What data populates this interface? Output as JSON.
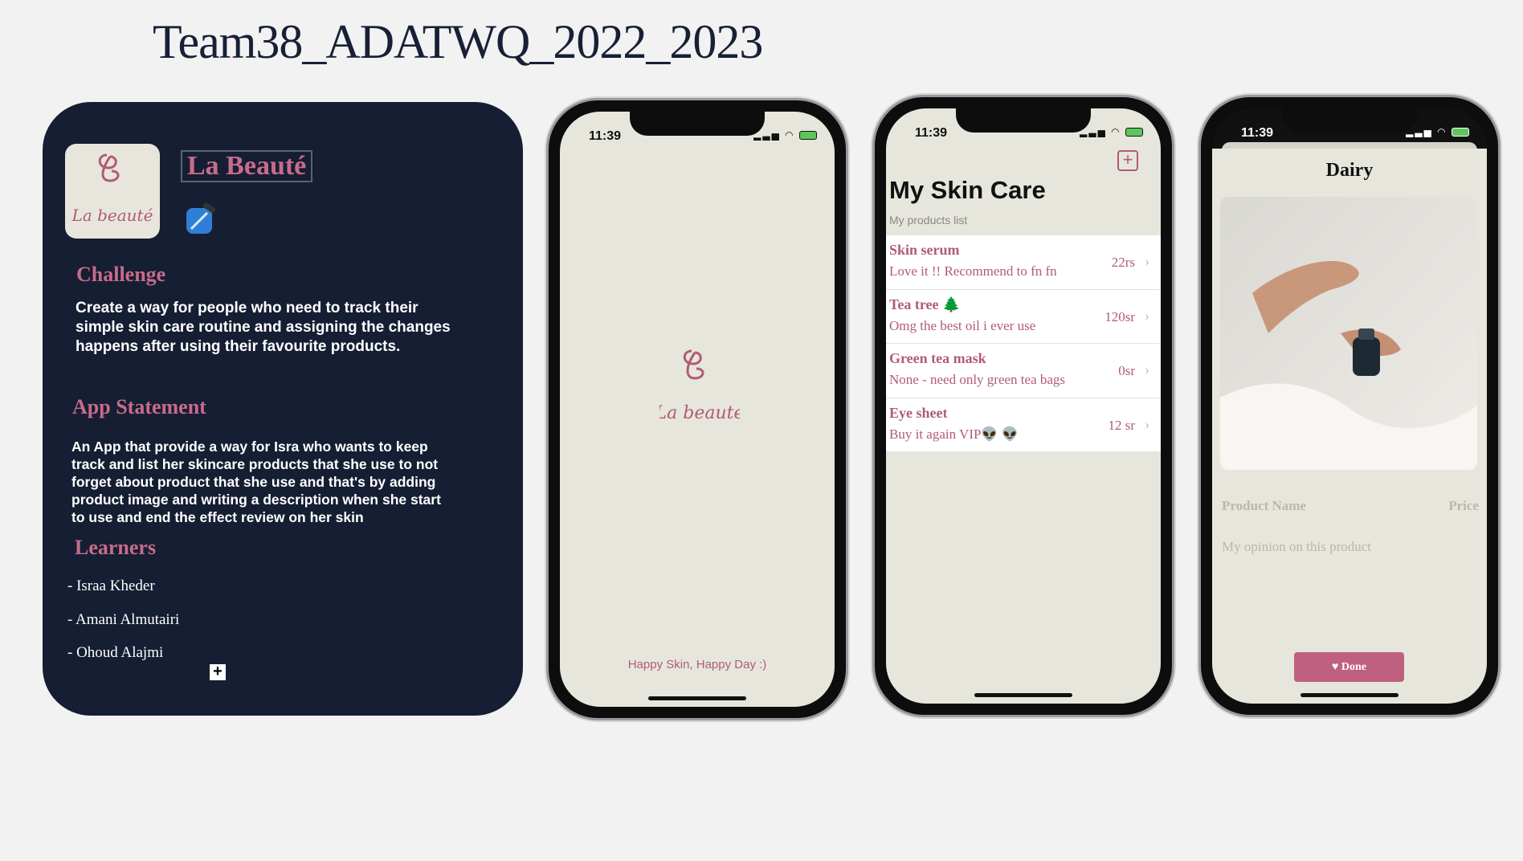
{
  "title": "Team38_ADATWQ_2022_2023",
  "colors": {
    "navy": "#151e33",
    "rose": "#c86b8a",
    "beige": "#e7e6dc"
  },
  "card": {
    "logo_text": "La beauté",
    "brand_name": "La Beauté",
    "icons": [
      "app-logo-icon",
      "xcode-icon"
    ],
    "challenge_heading": "Challenge",
    "challenge_text": "Create a way for people who need to track their simple skin care routine and assigning the changes happens after using their favourite products.",
    "statement_heading": "App Statement",
    "statement_text": "An App that provide a way for Isra who wants to keep track and list her skincare products that she use to not forget about product that she use and that's by adding product image and writing a description when she start to use and end the effect review on her skin",
    "learners_heading": "Learners",
    "learners": [
      "-  Israa Kheder",
      "-  Amani Almutairi",
      "- Ohoud  Alajmi"
    ],
    "plus_symbol": "+"
  },
  "splash": {
    "time": "11:39",
    "logo_text": "La beauté",
    "tagline": "Happy Skin, Happy Day :)"
  },
  "list_screen": {
    "time": "11:39",
    "add_symbol": "+",
    "title": "My Skin Care",
    "subtitle": "My products list",
    "chevron": "›",
    "rows": [
      {
        "name": "Skin serum",
        "desc": "Love it !! Recommend to fn fn",
        "price": "22rs"
      },
      {
        "name": "Tea tree 🌲",
        "desc": "Omg the best oil i ever use",
        "price": "120sr"
      },
      {
        "name": "Green tea mask",
        "desc": "None - need only green tea bags",
        "price": "0sr"
      },
      {
        "name": "Eye sheet",
        "desc": "Buy  it again VIP👽 👽",
        "price": "12 sr"
      }
    ]
  },
  "detail_screen": {
    "time": "11:39",
    "title": "Dairy",
    "product_name_placeholder": "Product Name",
    "price_placeholder": "Price",
    "opinion_placeholder": "My opinion on this product",
    "done_label": "Done",
    "done_icon": "heart-icon"
  }
}
